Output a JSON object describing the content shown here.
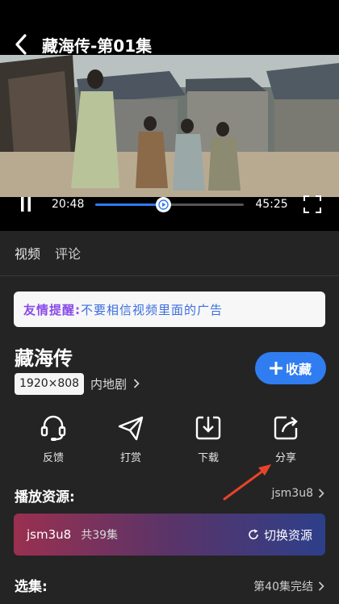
{
  "player": {
    "title": "藏海传-第01集",
    "current_time": "20:48",
    "total_time": "45:25",
    "progress": 0.46
  },
  "tabs": [
    {
      "label": "视频"
    },
    {
      "label": "评论"
    }
  ],
  "notice": {
    "head": "友情提醒:",
    "body": " 不要相信视频里面的广告"
  },
  "show": {
    "title": "藏海传",
    "resolution": "1920×808",
    "region": "内地剧",
    "collect_label": "收藏"
  },
  "actions": [
    {
      "label": "反馈",
      "icon": "headset-icon"
    },
    {
      "label": "打赏",
      "icon": "paper-plane-icon"
    },
    {
      "label": "下载",
      "icon": "download-icon"
    },
    {
      "label": "分享",
      "icon": "share-icon"
    }
  ],
  "source": {
    "heading": "播放资源:",
    "current": "jsm3u8",
    "bar_name": "jsm3u8",
    "bar_count": "共39集",
    "switch_label": "切换资源"
  },
  "episodes": {
    "heading": "选集:",
    "status": "第40集完结"
  },
  "colors": {
    "accent": "#2f7df0",
    "notice_head": "#8a4be8",
    "notice_body": "#3b6fe0",
    "annotation_arrow": "#e8432a"
  }
}
